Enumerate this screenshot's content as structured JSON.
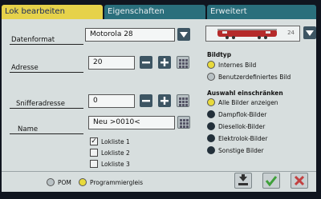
{
  "tabs": [
    {
      "label": "Lok bearbeiten"
    },
    {
      "label": "Eigenschaften"
    },
    {
      "label": "Erweitert"
    }
  ],
  "form": {
    "datenformat_label": "Datenformat",
    "datenformat_value": "Motorola 28",
    "adresse_label": "Adresse",
    "adresse_value": "20",
    "sniffer_label": "Snifferadresse",
    "sniffer_value": "0",
    "name_label": "Name",
    "name_value": "Neu >0010<"
  },
  "loklisten": [
    {
      "label": "Lokliste 1",
      "checked": true
    },
    {
      "label": "Lokliste 2",
      "checked": false
    },
    {
      "label": "Lokliste 3",
      "checked": false
    }
  ],
  "preview": {
    "number": "24"
  },
  "bildtyp": {
    "title": "Bildtyp",
    "options": [
      {
        "label": "Internes Bild",
        "state": "yellow"
      },
      {
        "label": "Benutzerdefiniertes Bild",
        "state": "gray"
      }
    ]
  },
  "auswahl": {
    "title": "Auswahl einschränken",
    "options": [
      {
        "label": "Alle Bilder anzeigen",
        "state": "yellow"
      },
      {
        "label": "Dampflok-Bilder",
        "state": "dark"
      },
      {
        "label": "Diesellok-Bilder",
        "state": "dark"
      },
      {
        "label": "Elektrolok-Bilder",
        "state": "dark"
      },
      {
        "label": "Sonstige Bilder",
        "state": "dark"
      }
    ]
  },
  "footer": {
    "pom_label": "POM",
    "prog_label": "Programmiergleis"
  },
  "colors": {
    "active_tab": "#e6d24a",
    "inactive_tab": "#2a6f7c",
    "panel": "#d7dede",
    "accept": "#3fa03a",
    "cancel": "#c24040"
  },
  "icons": {
    "dropdown": "triangle-down",
    "minus": "minus",
    "plus": "plus",
    "keypad": "grid",
    "save": "save-arrow",
    "ok": "checkmark",
    "cancel": "x-cross"
  }
}
